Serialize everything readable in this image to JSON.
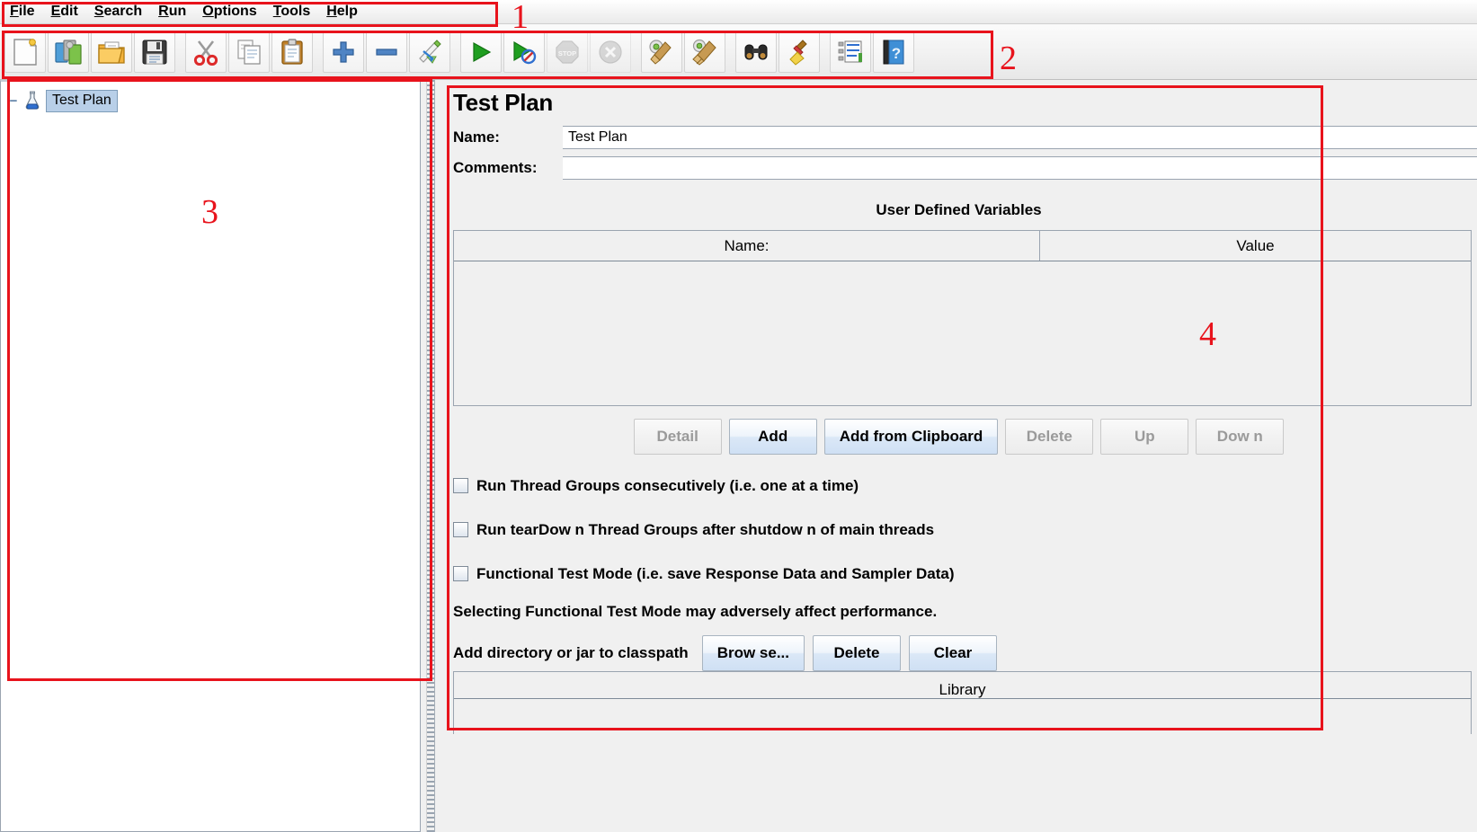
{
  "window": {
    "title": "Test Plan"
  },
  "menubar": {
    "items": [
      {
        "name": "file",
        "mnemonic": "F",
        "rest": "ile"
      },
      {
        "name": "edit",
        "mnemonic": "E",
        "rest": "dit"
      },
      {
        "name": "search",
        "mnemonic": "S",
        "rest": "earch"
      },
      {
        "name": "run",
        "mnemonic": "R",
        "rest": "un"
      },
      {
        "name": "options",
        "mnemonic": "O",
        "rest": "ptions"
      },
      {
        "name": "tools",
        "mnemonic": "T",
        "rest": "ools"
      },
      {
        "name": "help",
        "mnemonic": "H",
        "rest": "elp"
      }
    ]
  },
  "toolbar": {
    "buttons": [
      {
        "icon": "new-test-plan-icon",
        "tooltip": "New",
        "enabled": true
      },
      {
        "icon": "templates-icon",
        "tooltip": "Templates",
        "enabled": true
      },
      {
        "icon": "open-folder-icon",
        "tooltip": "Open",
        "enabled": true
      },
      {
        "icon": "save-floppy-icon",
        "tooltip": "Save Test Plan",
        "enabled": true
      },
      {
        "icon": "cut-scissors-icon",
        "tooltip": "Cut",
        "enabled": true
      },
      {
        "icon": "copy-pages-icon",
        "tooltip": "Copy",
        "enabled": true
      },
      {
        "icon": "paste-clipboard-icon",
        "tooltip": "Paste",
        "enabled": true
      },
      {
        "icon": "expand-plus-icon",
        "tooltip": "Expand All",
        "enabled": true
      },
      {
        "icon": "collapse-minus-icon",
        "tooltip": "Collapse All",
        "enabled": true
      },
      {
        "icon": "toggle-pencil-icon",
        "tooltip": "Toggle",
        "enabled": true
      },
      {
        "icon": "start-play-icon",
        "tooltip": "Start",
        "enabled": true
      },
      {
        "icon": "start-no-pauses-icon",
        "tooltip": "Start no pauses",
        "enabled": true
      },
      {
        "icon": "stop-sign-icon",
        "tooltip": "Stop",
        "enabled": false
      },
      {
        "icon": "shutdown-x-icon",
        "tooltip": "Shutdown",
        "enabled": false
      },
      {
        "icon": "clear-broom-icon",
        "tooltip": "Clear",
        "enabled": true
      },
      {
        "icon": "clear-all-broom-icon",
        "tooltip": "Clear All",
        "enabled": true
      },
      {
        "icon": "search-binoculars-icon",
        "tooltip": "Search",
        "enabled": true
      },
      {
        "icon": "reset-search-broom-icon",
        "tooltip": "Reset Search",
        "enabled": true
      },
      {
        "icon": "function-helper-list-icon",
        "tooltip": "Function Helper",
        "enabled": true
      },
      {
        "icon": "help-book-icon",
        "tooltip": "Help",
        "enabled": true
      }
    ]
  },
  "tree": {
    "root": {
      "label": "Test Plan",
      "icon": "test-plan-flask-icon",
      "selected": true,
      "expanded": true,
      "toggle": "−"
    }
  },
  "form": {
    "title": "Test Plan",
    "name_label": "Name:",
    "name_value": "Test Plan",
    "comments_label": "Comments:",
    "comments_value": "",
    "udv": {
      "title": "User Defined Variables",
      "columns": [
        "Name:",
        "Value"
      ],
      "rows": []
    },
    "udv_buttons": [
      {
        "label": "Detail",
        "enabled": false
      },
      {
        "label": "Add",
        "enabled": true
      },
      {
        "label": "Add from Clipboard",
        "enabled": true
      },
      {
        "label": "Delete",
        "enabled": false
      },
      {
        "label": "Up",
        "enabled": false
      },
      {
        "label": "Dow n",
        "enabled": false
      }
    ],
    "checkboxes": [
      {
        "label": "Run Thread Groups consecutively (i.e. one at a time)",
        "checked": false
      },
      {
        "label": "Run tearDow n Thread Groups after shutdow n of main threads",
        "checked": false
      },
      {
        "label": "Functional Test Mode (i.e. save Response Data and Sampler Data)",
        "checked": false
      }
    ],
    "note": "Selecting Functional Test Mode may adversely affect performance.",
    "classpath_label": "Add directory or jar to classpath",
    "classpath_buttons": [
      {
        "label": "Brow se...",
        "enabled": true
      },
      {
        "label": "Delete",
        "enabled": true
      },
      {
        "label": "Clear",
        "enabled": true
      }
    ],
    "library_header": "Library"
  },
  "annotations": {
    "color": "#e8131c",
    "markers": [
      {
        "number": "1",
        "target": "menu-bar"
      },
      {
        "number": "2",
        "target": "toolbar"
      },
      {
        "number": "3",
        "target": "test-plan-tree"
      },
      {
        "number": "4",
        "target": "test-plan-config-panel"
      }
    ]
  }
}
